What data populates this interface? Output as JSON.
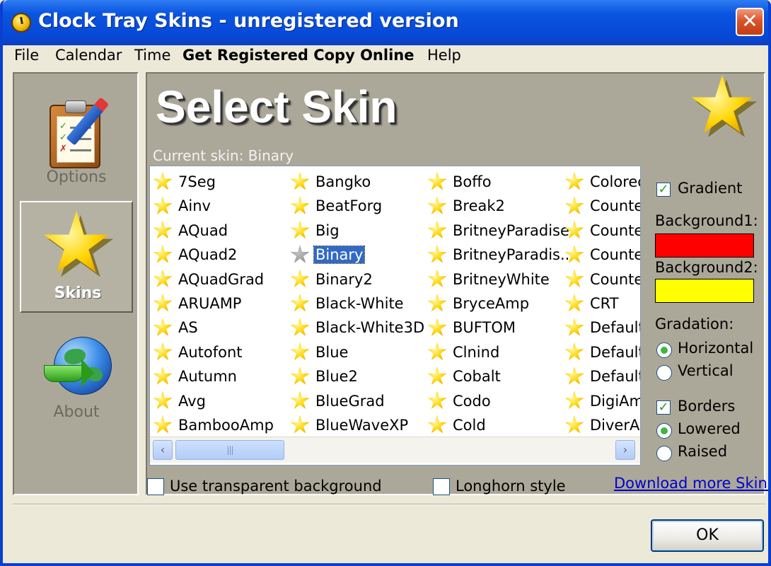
{
  "window": {
    "title": "Clock Tray Skins - unregistered version",
    "close_symbol": "✕"
  },
  "menu": [
    "File",
    "Calendar",
    "Time",
    "Get Registered Copy Online",
    "Help"
  ],
  "sidebar": {
    "items": [
      {
        "label": "Options",
        "icon": "clipboard-icon",
        "selected": false
      },
      {
        "label": "Skins",
        "icon": "star-icon",
        "selected": true
      },
      {
        "label": "About",
        "icon": "globe-icon",
        "selected": false
      }
    ]
  },
  "main": {
    "header_title": "Select Skin",
    "current_skin_text": "Current skin: Binary",
    "skins": {
      "columns": [
        [
          "7Seg",
          "Ainv",
          "AQuad",
          "AQuad2",
          "AQuadGrad",
          "ARUAMP",
          "AS",
          "Autofont",
          "Autumn",
          "Avg",
          "BambooAmp"
        ],
        [
          "Bangko",
          "BeatForg",
          "Big",
          "Binary",
          "Binary2",
          "Black-White",
          "Black-White3D",
          "Blue",
          "Blue2",
          "BlueGrad",
          "BlueWaveXP"
        ],
        [
          "Boffo",
          "Break2",
          "BritneyParadise",
          "BritneyParadis...",
          "BritneyWhite",
          "BryceAmp",
          "BUFTOM",
          "Clnind",
          "Cobalt",
          "Codo",
          "Cold"
        ],
        [
          "Colorec",
          "Counte",
          "Counte",
          "Counte",
          "Counte",
          "CRT",
          "Default",
          "Default",
          "Default",
          "DigiAm",
          "DiverAr"
        ]
      ],
      "selected": "Binary"
    },
    "scrollbar": {
      "left": "‹",
      "right": "›",
      "grip": "|||"
    }
  },
  "options": {
    "gradient_label": "Gradient",
    "gradient_checked": true,
    "background1_label": "Background1:",
    "background1_color": "#ff0000",
    "background2_label": "Background2:",
    "background2_color": "#ffff00",
    "gradation_label": "Gradation:",
    "horizontal_label": "Horizontal",
    "vertical_label": "Vertical",
    "gradation_selected": "Horizontal",
    "borders_label": "Borders",
    "borders_checked": true,
    "lowered_label": "Lowered",
    "raised_label": "Raised",
    "border_style_selected": "Lowered"
  },
  "bottom": {
    "transparent_label": "Use transparent background",
    "transparent_checked": false,
    "longhorn_label": "Longhorn style",
    "longhorn_checked": false,
    "download_link": "Download more Skins"
  },
  "ok_label": "OK",
  "colors": {
    "titlebar": "#0a55e0",
    "selection": "#316ac5",
    "panel": "#aca899"
  }
}
